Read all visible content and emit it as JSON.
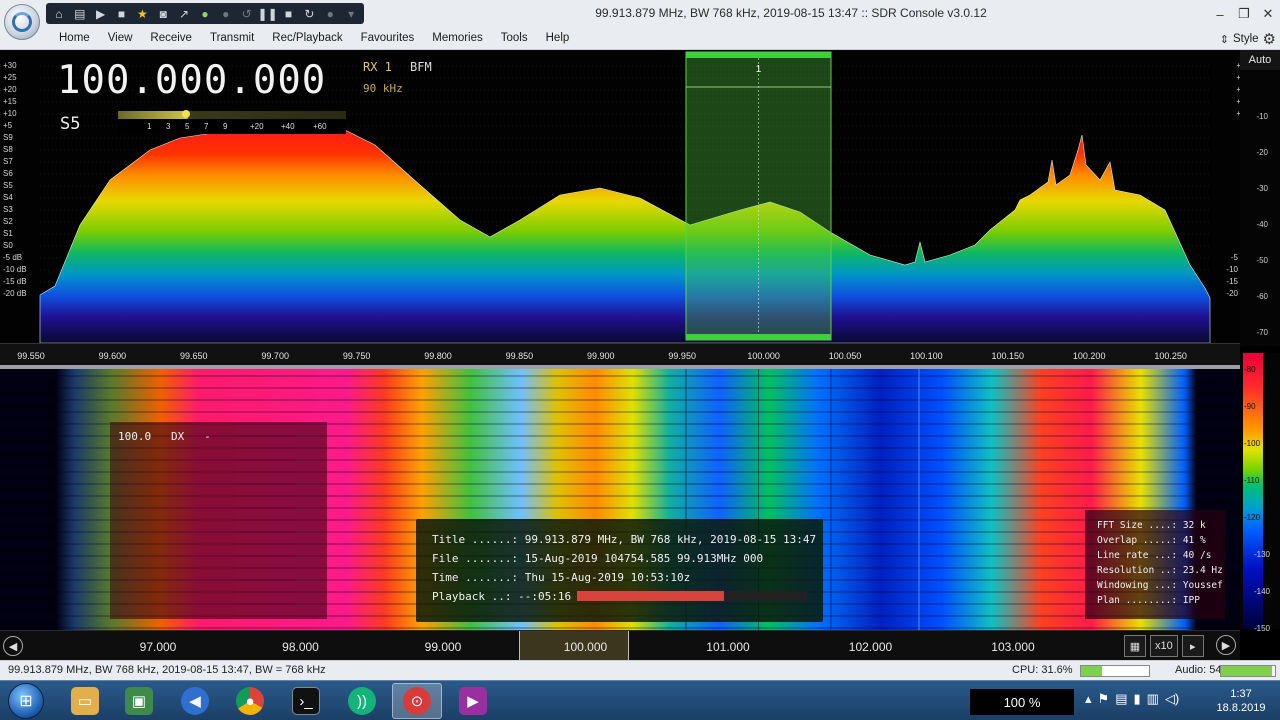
{
  "window": {
    "title": "99.913.879 MHz, BW 768 kHz, 2019-08-15 13:47 :: SDR Console v3.0.12",
    "controls": [
      "–",
      "❐",
      "✕"
    ]
  },
  "menu": {
    "items": [
      "Home",
      "View",
      "Receive",
      "Transmit",
      "Rec/Playback",
      "Favourites",
      "Memories",
      "Tools",
      "Help"
    ],
    "style_label": "Style"
  },
  "receiver": {
    "frequency": "100.000.000",
    "rx": "RX 1",
    "mode": "BFM",
    "bandwidth": "90 kHz",
    "smeter_value": "S5",
    "smeter_ticks": [
      "1",
      "3",
      "5",
      "7",
      "9",
      "+20",
      "+40",
      "+60"
    ],
    "smeter_level_fraction": 0.3,
    "filter_marker": "1"
  },
  "spectrum": {
    "db_left": [
      "+30",
      "+25",
      "+20",
      "+15",
      "+10",
      "+5",
      "S9",
      "S8",
      "S7",
      "S6",
      "S5",
      "S4",
      "S3",
      "S2",
      "S1",
      "S0",
      "-5 dB",
      "-10 dB",
      "-15 dB",
      "-20 dB"
    ],
    "db_right_outer": [
      "-10",
      "-20",
      "-30",
      "-40",
      "-50",
      "-60",
      "-70"
    ],
    "auto_label": "Auto",
    "freq_labels": [
      "99.550",
      "99.600",
      "99.650",
      "99.700",
      "99.750",
      "99.800",
      "99.850",
      "99.900",
      "99.950",
      "100.000",
      "100.050",
      "100.100",
      "100.150",
      "100.200",
      "100.250"
    ]
  },
  "waterfall": {
    "colorbar_labels": [
      "-80",
      "-90",
      "-100",
      "-110",
      "-120",
      "-130",
      "-140",
      "-150"
    ],
    "dx_text": "100.0   DX   -",
    "info": {
      "title_label": "Title ......:",
      "title_value": "99.913.879 MHz, BW 768 kHz, 2019-08-15 13:47",
      "file_label": "File .......:",
      "file_value": "15-Aug-2019 104754.585 99.913MHz 000",
      "time_label": "Time .......:",
      "time_value": "Thu 15-Aug-2019 10:53:10z",
      "playback_label": "Playback ..:",
      "playback_value": "--:05:16",
      "playback_fraction": 0.64
    },
    "fft": [
      {
        "label": "FFT Size ....:",
        "value": "32 k"
      },
      {
        "label": "Overlap .....:",
        "value": "41 %"
      },
      {
        "label": "Line rate ...:",
        "value": "40 /s"
      },
      {
        "label": "Resolution ..:",
        "value": "23.4 Hz"
      },
      {
        "label": "Windowing ...:",
        "value": "Youssef"
      },
      {
        "label": "Plan ........:",
        "value": "IPP"
      }
    ]
  },
  "band": {
    "labels": [
      "97.000",
      "98.000",
      "99.000",
      "100.000",
      "101.000",
      "102.000",
      "103.000"
    ],
    "zoom": "x10"
  },
  "status": {
    "text": "99.913.879 MHz, BW 768 kHz, 2019-08-15 13:47, BW = 768 kHz",
    "cpu": "CPU: 31.6%",
    "cpu_fraction": 0.316,
    "audio": "Audio: 54ms",
    "audio_fraction": 0.95
  },
  "taskbar": {
    "zoom": "100 %",
    "time": "1:37",
    "date": "18.8.2019"
  }
}
